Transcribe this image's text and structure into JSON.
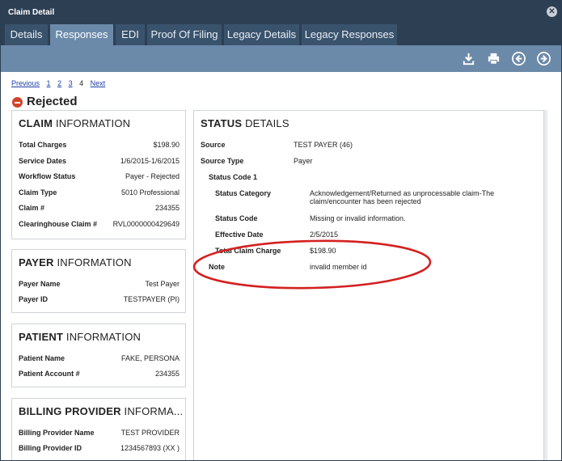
{
  "window": {
    "title": "Claim Detail",
    "close_icon": "close-icon"
  },
  "tabs": [
    {
      "label": "Details",
      "active": false
    },
    {
      "label": "Responses",
      "active": true
    },
    {
      "label": "EDI",
      "active": false
    },
    {
      "label": "Proof Of Filing",
      "active": false
    },
    {
      "label": "Legacy Details",
      "active": false
    },
    {
      "label": "Legacy Responses",
      "active": false
    }
  ],
  "toolbar": {
    "icons": [
      "download-icon",
      "print-icon",
      "previous-icon",
      "next-icon"
    ]
  },
  "pager": {
    "previous": "Previous",
    "pages": [
      "1",
      "2",
      "3",
      "4"
    ],
    "current": "4",
    "next": "Next"
  },
  "status": {
    "label": "Rejected",
    "color": "#d0452a"
  },
  "claim_info": {
    "title_bold": "CLAIM",
    "title_rest": "INFORMATION",
    "rows": [
      {
        "key": "Total Charges",
        "value": "$198.90"
      },
      {
        "key": "Service Dates",
        "value": "1/6/2015-1/6/2015"
      },
      {
        "key": "Workflow Status",
        "value": "Payer - Rejected"
      },
      {
        "key": "Claim Type",
        "value": "5010 Professional"
      },
      {
        "key": "Claim #",
        "value": "234355"
      },
      {
        "key": "Clearinghouse Claim #",
        "value": "RVL0000000429649"
      }
    ]
  },
  "payer_info": {
    "title_bold": "PAYER",
    "title_rest": "INFORMATION",
    "rows": [
      {
        "key": "Payer Name",
        "value": "Test Payer"
      },
      {
        "key": "Payer ID",
        "value": "TESTPAYER (PI)"
      }
    ]
  },
  "patient_info": {
    "title_bold": "PATIENT",
    "title_rest": "INFORMATION",
    "rows": [
      {
        "key": "Patient Name",
        "value": "FAKE, PERSONA"
      },
      {
        "key": "Patient Account #",
        "value": "234355"
      }
    ]
  },
  "billing_info": {
    "title_bold": "BILLING PROVIDER",
    "title_rest": "INFORMA...",
    "rows": [
      {
        "key": "Billing Provider Name",
        "value": "TEST PROVIDER"
      },
      {
        "key": "Billing Provider ID",
        "value": "1234567893 (XX )"
      }
    ]
  },
  "status_details": {
    "title_bold": "STATUS",
    "title_rest": "DETAILS",
    "source_label": "Source",
    "source_value": "TEST PAYER (46)",
    "source_type_label": "Source Type",
    "source_type_value": "Payer",
    "status_code_header": "Status Code 1",
    "status_category_label": "Status Category",
    "status_category_value": "Acknowledgement/Returned as unprocessable claim-The claim/encounter has been rejected",
    "status_code_label": "Status Code",
    "status_code_value": "Missing or invalid information.",
    "effective_date_label": "Effective Date",
    "effective_date_value": "2/5/2015",
    "total_claim_charge_label": "Total Claim Charge",
    "total_claim_charge_value": "$198.90",
    "note_label": "Note",
    "note_value": "invalid member id"
  },
  "colors": {
    "titlebar": "#2d3f53",
    "tab": "#3a536d",
    "tab_active": "#6b8aaa",
    "toolbar": "#6b89a8",
    "highlight_ellipse": "#d42020"
  }
}
